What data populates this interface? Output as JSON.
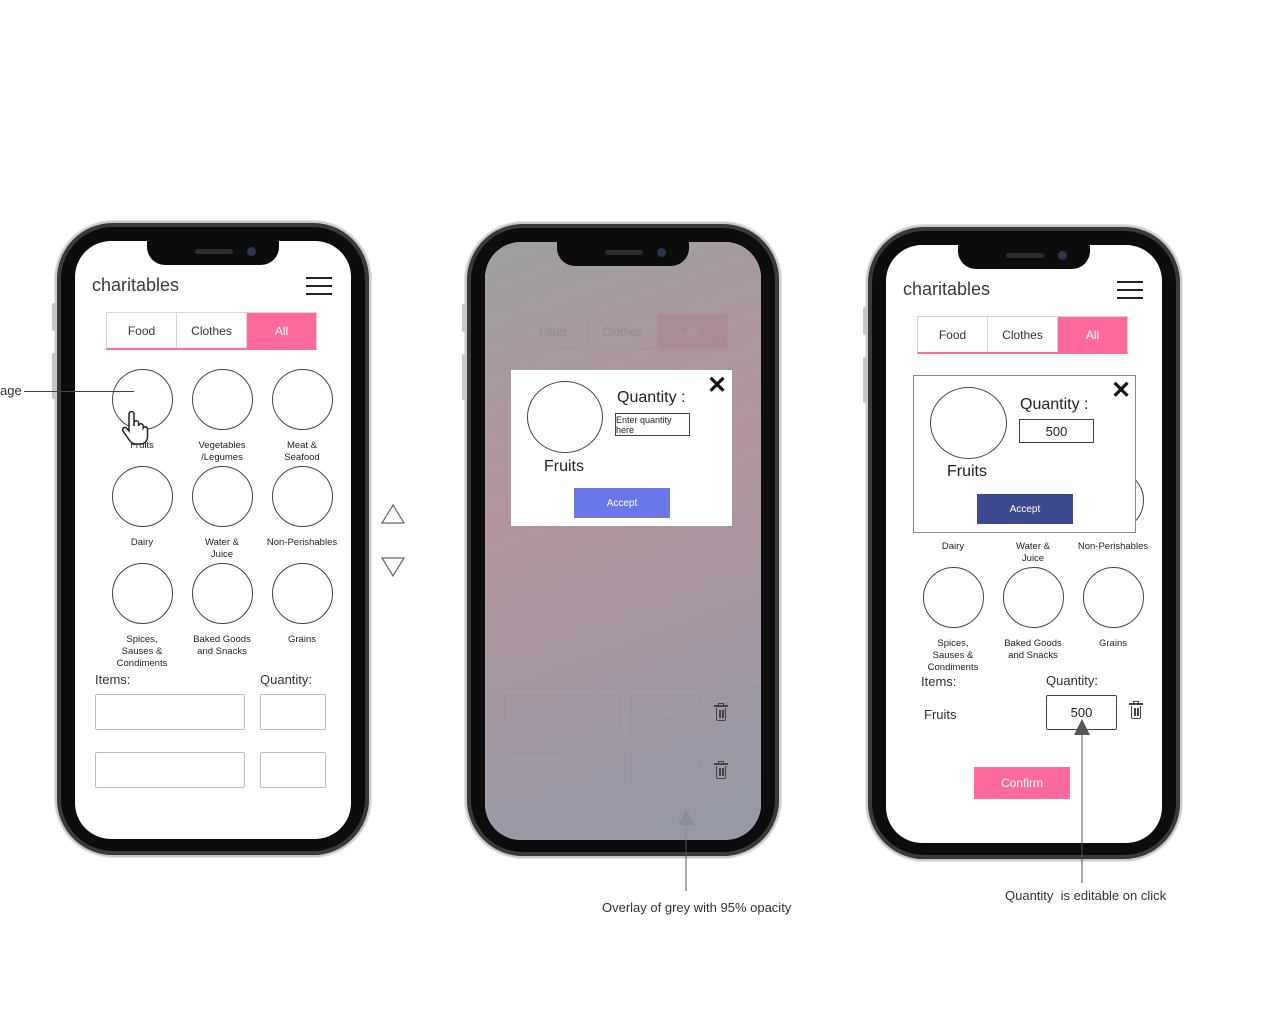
{
  "app": {
    "brand": "charitables"
  },
  "tabs": [
    "Food",
    "Clothes",
    "All"
  ],
  "categories": [
    "Fruits",
    "Vegetables /Legumes",
    "Meat & Seafood",
    "Dairy",
    "Water & Juice",
    "Non-Perishables",
    "Spices, Sauses & Condiments",
    "Baked Goods and Snacks",
    "Grains"
  ],
  "category_lines": [
    [
      "Fruits"
    ],
    [
      "Vegetables",
      "/Legumes"
    ],
    [
      "Meat &",
      "Seafood"
    ],
    [
      "Dairy"
    ],
    [
      "Water &",
      "Juice"
    ],
    [
      "Non-Perishables"
    ],
    [
      "Spices,",
      "Sauses &",
      "Condiments"
    ],
    [
      "Baked Goods",
      "and Snacks"
    ],
    [
      "Grains"
    ]
  ],
  "form": {
    "items_label": "Items:",
    "quantity_label": "Quantity:"
  },
  "modal": {
    "item_name": "Fruits",
    "quantity_label": "Quantity :",
    "quantity_placeholder": "Enter quantity here",
    "quantity_value": "500",
    "accept_label": "Accept",
    "close_symbol": "✕"
  },
  "cart": {
    "item": "Fruits",
    "quantity": "500"
  },
  "confirm_label": "Confirm",
  "annotations": {
    "left_cut": "age",
    "overlay": "Overlay of grey with 95% opacity",
    "editable": "Quantity  is editable on click"
  },
  "colors": {
    "accent_pink": "#ff6a9e",
    "accept_light": "#6b77e8",
    "accept_dark": "#3e4a8f"
  }
}
